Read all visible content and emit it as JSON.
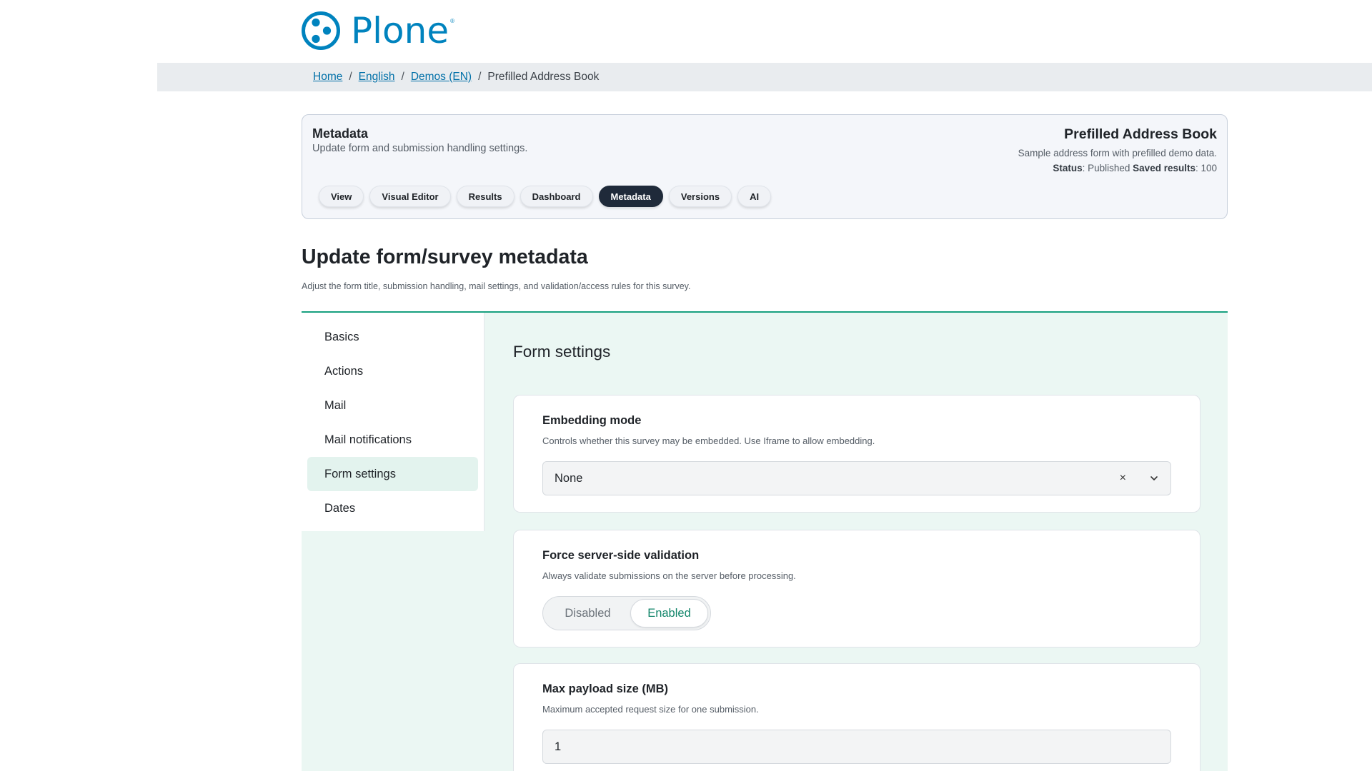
{
  "logo": {
    "text": "Plone",
    "reg": "®"
  },
  "breadcrumb": {
    "items": [
      "Home",
      "English",
      "Demos (EN)"
    ],
    "current": "Prefilled Address Book",
    "separator": "/"
  },
  "header": {
    "title": "Metadata",
    "subtitle": "Update form and submission handling settings.",
    "form_title": "Prefilled Address Book",
    "form_description": "Sample address form with prefilled demo data.",
    "status_label": "Status",
    "status_value": ": Published ",
    "saved_results_label": "Saved results",
    "saved_results_value": ": 100",
    "tabs": [
      {
        "label": "View"
      },
      {
        "label": "Visual Editor"
      },
      {
        "label": "Results"
      },
      {
        "label": "Dashboard"
      },
      {
        "label": "Metadata",
        "active": true
      },
      {
        "label": "Versions"
      },
      {
        "label": "AI"
      }
    ]
  },
  "page": {
    "title": "Update form/survey metadata",
    "description": "Adjust the form title, submission handling, mail settings, and validation/access rules for this survey."
  },
  "side_nav": {
    "items": [
      {
        "label": "Basics"
      },
      {
        "label": "Actions"
      },
      {
        "label": "Mail"
      },
      {
        "label": "Mail notifications"
      },
      {
        "label": "Form settings",
        "active": true
      },
      {
        "label": "Dates"
      }
    ]
  },
  "section": {
    "title": "Form settings"
  },
  "fields": {
    "embedding": {
      "label": "Embedding mode",
      "help": "Controls whether this survey may be embedded. Use Iframe to allow embedding.",
      "value": "None",
      "clear_glyph": "×"
    },
    "server_validation": {
      "label": "Force server-side validation",
      "help": "Always validate submissions on the server before processing.",
      "options": [
        "Disabled",
        "Enabled"
      ],
      "selected": "Enabled"
    },
    "max_payload": {
      "label": "Max payload size (MB)",
      "help": "Maximum accepted request size for one submission.",
      "value": "1"
    }
  },
  "colors": {
    "brand": "#0083be",
    "accent": "#17a07f",
    "active_tab": "#1f2a3a",
    "panel_bg": "#ebf7f3"
  }
}
